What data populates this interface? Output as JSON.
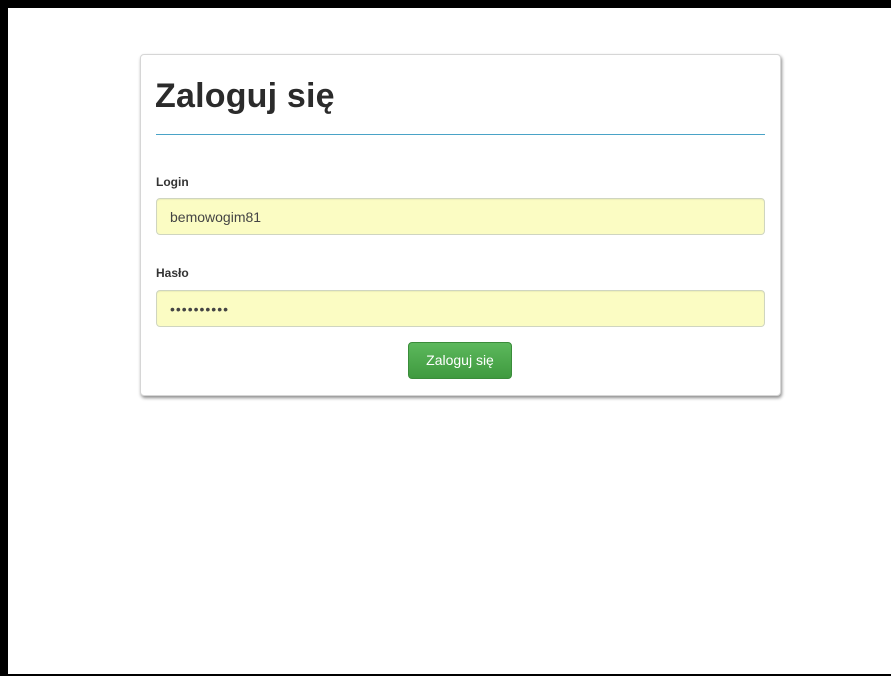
{
  "login_form": {
    "title": "Zaloguj się",
    "login": {
      "label": "Login",
      "value": "bemowogim81"
    },
    "password": {
      "label": "Hasło",
      "value": "••••••••••"
    },
    "submit_label": "Zaloguj się"
  },
  "colors": {
    "input_autofill_background": "#fbfcc3",
    "title_rule": "#4aa3c7",
    "submit_button": "#4cae4c"
  }
}
